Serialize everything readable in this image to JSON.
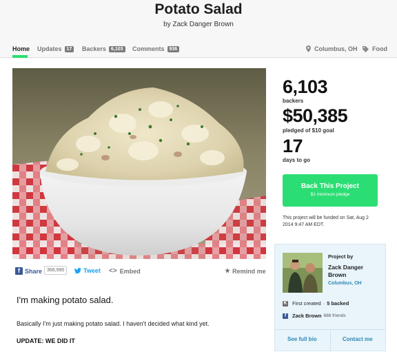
{
  "header": {
    "title": "Potato Salad",
    "byline": "by Zack Danger Brown"
  },
  "nav": {
    "home": "Home",
    "updates": "Updates",
    "updates_count": "17",
    "backers": "Backers",
    "backers_count": "6,103",
    "comments": "Comments",
    "comments_count": "936",
    "location": "Columbus, OH",
    "category": "Food"
  },
  "share": {
    "share_label": "Share",
    "share_count": "366,990",
    "tweet_label": "Tweet",
    "embed_label": "Embed",
    "remind_label": "Remind me"
  },
  "description": {
    "headline": "I'm making potato salad.",
    "paragraph": "Basically I'm just making potato salad. I haven't decided what kind yet.",
    "update": "UPDATE: WE DID IT"
  },
  "stats": {
    "backers_value": "6,103",
    "backers_label": "backers",
    "pledged_value": "$50,385",
    "pledged_label": "pledged of $10 goal",
    "days_value": "17",
    "days_label": "days to go"
  },
  "cta": {
    "button_label": "Back This Project",
    "button_sub": "$1 minimum pledge",
    "funded_note": "This project will be funded on Sat, Aug 2 2014 9:47 AM EDT."
  },
  "creator": {
    "project_by_label": "Project by",
    "name_line1": "Zack Danger",
    "name_line2": "Brown",
    "location": "Columbus, OH",
    "first_created": "First created",
    "backed_count": "5 backed",
    "fb_name": "Zack Brown",
    "fb_friends": "688 friends",
    "see_bio": "See full bio",
    "contact": "Contact me"
  },
  "colors": {
    "accent_green": "#2bde73",
    "link_blue": "#2c89b3",
    "facebook_blue": "#3b5998",
    "twitter_blue": "#1da1f2"
  }
}
